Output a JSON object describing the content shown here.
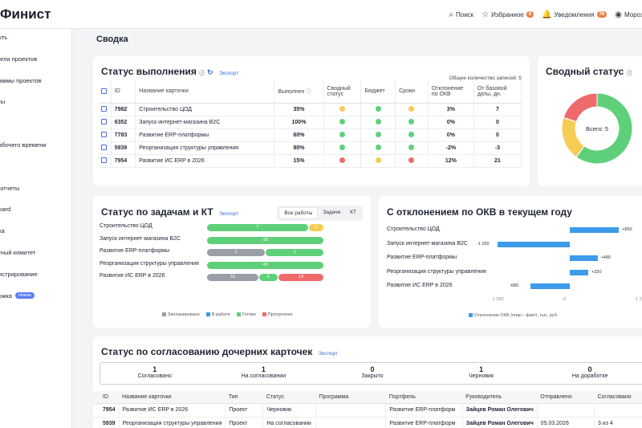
{
  "header": {
    "logo": "Финист",
    "nav": [
      {
        "label": "Поиск",
        "icon": "search-icon",
        "glyph": "⌕"
      },
      {
        "label": "Избранное",
        "icon": "star-icon",
        "glyph": "☆",
        "badge": "8"
      },
      {
        "label": "Уведомления",
        "icon": "bell-icon",
        "glyph": "🔔",
        "badge": "76"
      },
      {
        "label": "Морозо",
        "icon": "user-icon",
        "glyph": "◉"
      }
    ]
  },
  "sidebar": {
    "items": [
      {
        "label": "ауть"
      },
      {
        "label": "фели проектов"
      },
      {
        "label": "раммы проектов"
      },
      {
        "label": "кты"
      },
      {
        "label": "и"
      },
      {
        "label": "рабочего времени"
      },
      {
        "label": "ы"
      },
      {
        "label": "с-отчеты"
      },
      {
        "label": "board"
      },
      {
        "label": "ика"
      },
      {
        "label": "ктный комитет"
      },
      {
        "label": "нистрирование"
      },
      {
        "label": "ержка",
        "badge": "Новое"
      }
    ]
  },
  "page_title": "Сводка",
  "status_card": {
    "title": "Статус выполнения",
    "export": "Экспорт",
    "total": "Общее количество записей: 5",
    "columns": [
      "ID",
      "Название карточки",
      "Выполнен",
      "Сводный статус",
      "Бюджет",
      "Сроки",
      "Отклонение по ОКВ",
      "От базовой даты, дн."
    ],
    "rows": [
      {
        "id": "7982",
        "name": "Строительство ЦОД",
        "done": "35%",
        "summary": "y",
        "budget": "g",
        "terms": "y",
        "dev": "3%",
        "days": "7"
      },
      {
        "id": "6352",
        "name": "Запуск интернет-магазина B2C",
        "done": "100%",
        "summary": "g",
        "budget": "g",
        "terms": "g",
        "dev": "0%",
        "days": "0"
      },
      {
        "id": "7783",
        "name": "Развитие ERP-платформы",
        "done": "60%",
        "summary": "g",
        "budget": "g",
        "terms": "g",
        "dev": "0%",
        "days": "0"
      },
      {
        "id": "5939",
        "name": "Реорганизация структуры управления",
        "done": "80%",
        "summary": "g",
        "budget": "g",
        "terms": "g",
        "dev": "-2%",
        "days": "-3"
      },
      {
        "id": "7954",
        "name": "Развитие ИС ERP в 2026",
        "done": "15%",
        "summary": "r",
        "budget": "y",
        "terms": "r",
        "dev": "12%",
        "days": "21"
      }
    ]
  },
  "summary_card": {
    "title": "Сводный статус",
    "center": "Всего: 5",
    "slices": [
      {
        "status": "green",
        "color": "#5fd07a",
        "value": 3
      },
      {
        "status": "yellow",
        "color": "#f7cc55",
        "value": 1
      },
      {
        "status": "red",
        "color": "#ef6a6a",
        "value": 1
      }
    ]
  },
  "tasks_card": {
    "title": "Статус по задачам и КТ",
    "export": "Экспорт",
    "tabs": [
      "Все работы",
      "Задачи",
      "КТ"
    ],
    "rows": [
      {
        "name": "Строительство ЦОД",
        "segments": [
          {
            "v": 7,
            "c": "#5fd07a"
          },
          {
            "v": 1,
            "c": "#f7cc55"
          }
        ]
      },
      {
        "name": "Запуск интернет-магазина B2C",
        "segments": [
          {
            "v": 18,
            "c": "#5fd07a"
          }
        ]
      },
      {
        "name": "Развитие ERP-платформы",
        "segments": [
          {
            "v": 1,
            "c": "#9a9ea6"
          },
          {
            "v": 1,
            "c": "#5fd07a"
          }
        ]
      },
      {
        "name": "Реорганизация структуры управления",
        "segments": [
          {
            "v": 43,
            "c": "#5fd07a"
          }
        ]
      },
      {
        "name": "Развитие ИС ERP в 2026",
        "segments": [
          {
            "v": 16,
            "c": "#9a9ea6"
          },
          {
            "v": 6,
            "c": "#5fd07a"
          },
          {
            "v": 14,
            "c": "#ef6a6a"
          }
        ]
      }
    ],
    "legend": [
      {
        "label": "Запланировано",
        "color": "#9a9ea6"
      },
      {
        "label": "В работе",
        "color": "#3e9bea"
      },
      {
        "label": "Готово",
        "color": "#5fd07a"
      },
      {
        "label": "Просрочено",
        "color": "#ef6a6a"
      }
    ]
  },
  "deviation_card": {
    "title": "С отклонением по ОКВ в текущем году",
    "legend": "Отклонение ОКВ (план - факт), тыс. руб.",
    "ticks": [
      "-1 250",
      "0",
      "1 250"
    ],
    "rows": [
      {
        "name": "Строительство ЦОД",
        "value": 850,
        "label": "+850"
      },
      {
        "name": "Запуск интернет-магазина B2C",
        "value": -1250,
        "label": "-1 250"
      },
      {
        "name": "Развитие ERP-платформы",
        "value": 480,
        "label": "+480"
      },
      {
        "name": "Реорганизация структуры управления",
        "value": 320,
        "label": "+320"
      },
      {
        "name": "Развитие ИС ERP в 2026",
        "value": -680,
        "label": "-680"
      }
    ]
  },
  "approvals_card": {
    "title": "Статус по согласованию дочерних карточек",
    "export": "Экспорт",
    "summary": [
      {
        "count": "1",
        "label": "Согласовано"
      },
      {
        "count": "1",
        "label": "На согласовании"
      },
      {
        "count": "0",
        "label": "Закрыто"
      },
      {
        "count": "1",
        "label": "Черновик"
      },
      {
        "count": "0",
        "label": "На доработке"
      }
    ],
    "columns": [
      "ID",
      "Название карточки",
      "Тип",
      "Статус",
      "Программа",
      "Портфель",
      "Руководитель",
      "Отправлено",
      "Согласовано"
    ],
    "rows": [
      [
        "7954",
        "Развитие ИС ERP в 2026",
        "Проект",
        "Черновик",
        "",
        "Развитие ERP-платформ",
        "Зайцев Роман Олегович",
        "",
        ""
      ],
      [
        "5939",
        "Реорганизация структуры управления",
        "Проект",
        "На согласовании",
        "",
        "Развитие ERP-платформ",
        "Зайцев Роман Олегович",
        "05.03.2026",
        "3 из 4"
      ]
    ]
  }
}
